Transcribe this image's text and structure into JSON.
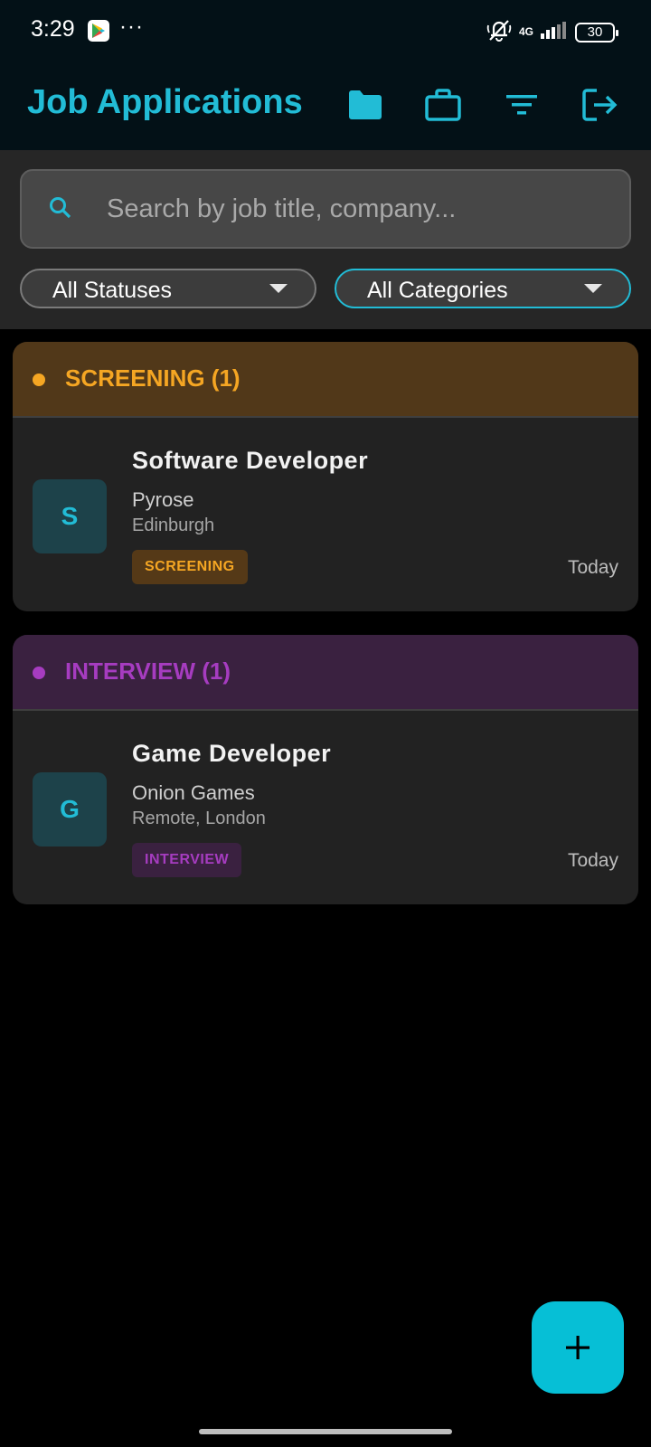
{
  "status_bar": {
    "time": "3:29",
    "dots": "···",
    "network": "4G",
    "battery": "30",
    "icons": [
      "play-store-icon",
      "bell-muted-icon",
      "signal-icon",
      "battery-icon"
    ]
  },
  "app_bar": {
    "title": "Job Applications",
    "actions": [
      "folder-icon",
      "briefcase-icon",
      "filter-icon",
      "logout-icon"
    ]
  },
  "search": {
    "placeholder": "Search by job title, company...",
    "value": ""
  },
  "filters": {
    "status": {
      "selected": "All Statuses"
    },
    "category": {
      "selected": "All Categories"
    }
  },
  "groups": [
    {
      "title": "SCREENING (1)",
      "color": "#f5a623",
      "header_bg": "#513819",
      "jobs": [
        {
          "avatar": "S",
          "title": "Software Developer",
          "company": "Pyrose",
          "location": "Edinburgh",
          "status": "SCREENING",
          "status_color": "#f5a623",
          "status_bg": "#553917",
          "date": "Today"
        }
      ]
    },
    {
      "title": "INTERVIEW (1)",
      "color": "#a63cc0",
      "header_bg": "#3a2140",
      "jobs": [
        {
          "avatar": "G",
          "title": "Game Developer",
          "company": "Onion Games",
          "location": "Remote, London",
          "status": "INTERVIEW",
          "status_color": "#a63cc0",
          "status_bg": "#3a2140",
          "date": "Today"
        }
      ]
    }
  ],
  "fab": {
    "icon": "plus-icon"
  },
  "colors": {
    "accent": "#22bcd6",
    "background": "#000000"
  }
}
